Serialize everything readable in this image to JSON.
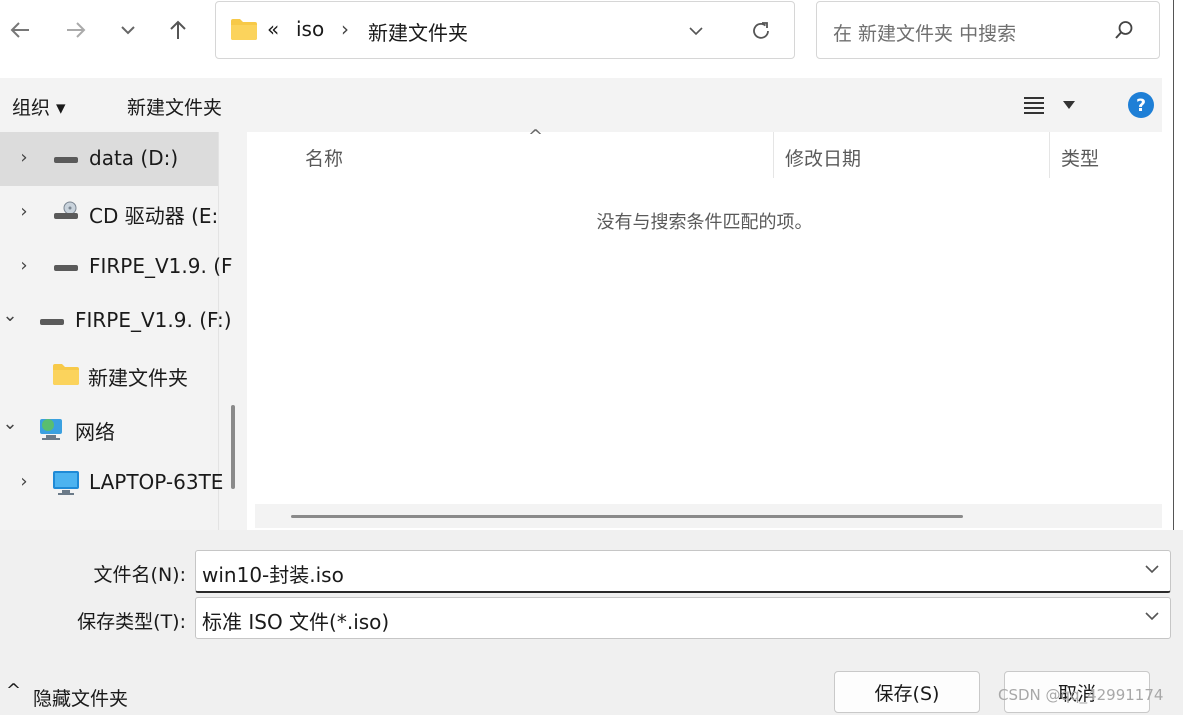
{
  "address": {
    "overflow_label": "«",
    "crumbs": [
      "iso",
      "新建文件夹"
    ]
  },
  "search": {
    "placeholder": "在 新建文件夹 中搜索"
  },
  "toolbar": {
    "organize_label": "组织 ▾",
    "new_folder_label": "新建文件夹"
  },
  "nav_pane": {
    "items": [
      {
        "label": "data (D:)",
        "icon": "drive-icon",
        "chevron": "›",
        "selected": true
      },
      {
        "label": "CD 驱动器 (E:",
        "icon": "cd-drive-icon",
        "chevron": "›"
      },
      {
        "label": "FIRPE_V1.9. (F",
        "icon": "drive-icon",
        "chevron": "›"
      },
      {
        "label": "FIRPE_V1.9. (F:)",
        "icon": "drive-icon",
        "chevron": "⌄"
      },
      {
        "label": "新建文件夹",
        "icon": "folder-icon",
        "chevron": ""
      },
      {
        "label": "网络",
        "icon": "network-icon",
        "chevron": "⌄"
      },
      {
        "label": "LAPTOP-63TE",
        "icon": "computer-icon",
        "chevron": "›"
      }
    ]
  },
  "content": {
    "columns": [
      "名称",
      "修改日期",
      "类型"
    ],
    "sort_indicator": "^",
    "empty_message": "没有与搜索条件匹配的项。"
  },
  "form": {
    "filename_label": "文件名(N):",
    "filename_value": "win10-封装.iso",
    "filetype_label": "保存类型(T):",
    "filetype_value": "标准 ISO 文件(*.iso)"
  },
  "footer": {
    "hide_folders_label": "隐藏文件夹",
    "hide_folders_glyph": "^",
    "save_label": "保存(S)",
    "cancel_label": "取消"
  },
  "watermark": "CSDN @qq_42991174",
  "colors": {
    "accent": "#0078d4",
    "folder": "#f7c948",
    "toolbar_bg": "#f3f3f3"
  }
}
